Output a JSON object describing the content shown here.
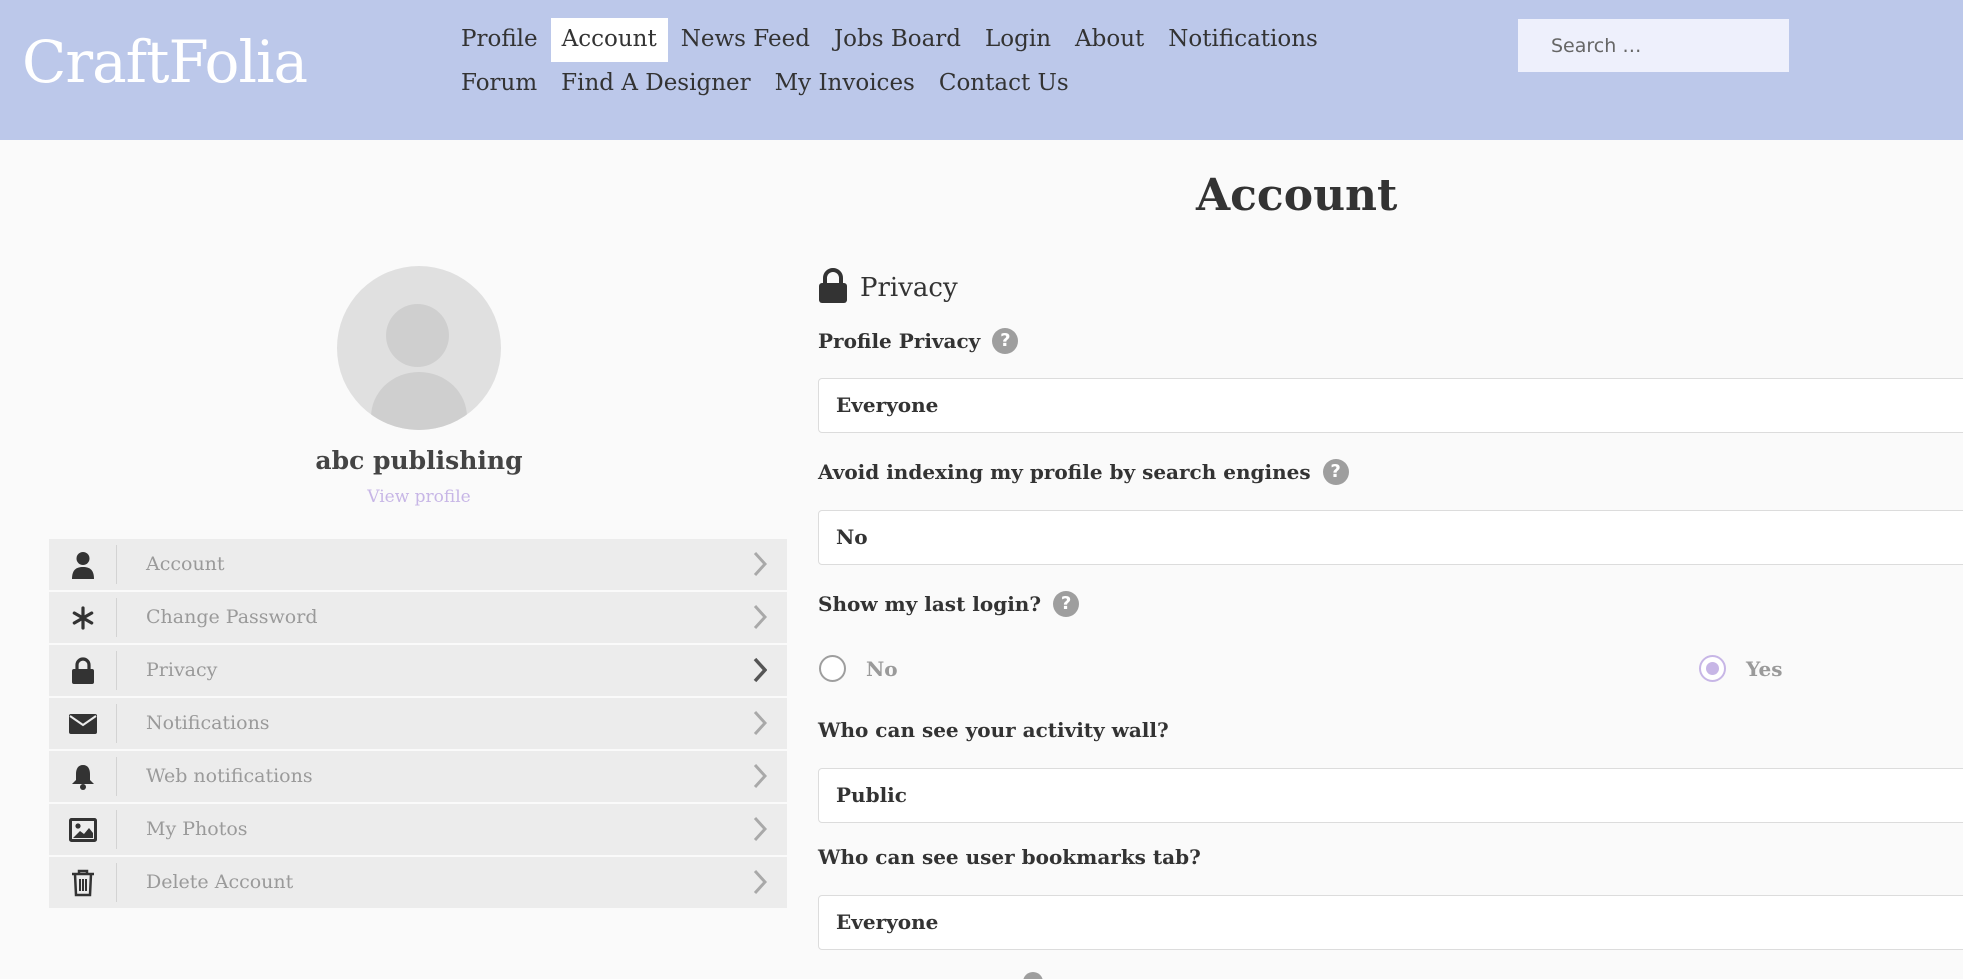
{
  "site": {
    "logo": "CraftFolia"
  },
  "nav": {
    "items": [
      {
        "label": "Profile",
        "active": false
      },
      {
        "label": "Account",
        "active": true
      },
      {
        "label": "News Feed",
        "active": false
      },
      {
        "label": "Jobs Board",
        "active": false
      },
      {
        "label": "Login",
        "active": false
      },
      {
        "label": "About",
        "active": false
      },
      {
        "label": "Notifications",
        "active": false
      },
      {
        "label": "Forum",
        "active": false
      },
      {
        "label": "Find A Designer",
        "active": false
      },
      {
        "label": "My Invoices",
        "active": false
      },
      {
        "label": "Contact Us",
        "active": false
      }
    ]
  },
  "search": {
    "placeholder": "Search …"
  },
  "page": {
    "title": "Account"
  },
  "user": {
    "name": "abc publishing",
    "view_profile": "View profile"
  },
  "sidebar": {
    "items": [
      {
        "label": "Account",
        "icon": "user-icon"
      },
      {
        "label": "Change Password",
        "icon": "asterisk-icon"
      },
      {
        "label": "Privacy",
        "icon": "lock-icon"
      },
      {
        "label": "Notifications",
        "icon": "envelope-icon"
      },
      {
        "label": "Web notifications",
        "icon": "bell-icon"
      },
      {
        "label": "My Photos",
        "icon": "image-icon"
      },
      {
        "label": "Delete Account",
        "icon": "trash-icon"
      }
    ]
  },
  "privacy": {
    "section_title": "Privacy",
    "profile_privacy": {
      "label": "Profile Privacy",
      "value": "Everyone"
    },
    "avoid_indexing": {
      "label": "Avoid indexing my profile by search engines",
      "value": "No"
    },
    "show_last_login": {
      "label": "Show my last login?",
      "options": [
        "No",
        "Yes"
      ],
      "selected": "Yes"
    },
    "activity_wall": {
      "label": "Who can see your activity wall?",
      "value": "Public"
    },
    "bookmarks_tab": {
      "label": "Who can see user bookmarks tab?",
      "value": "Everyone"
    }
  },
  "colors": {
    "header_bg": "#bcc8ea",
    "accent": "#c7b6e6",
    "help_icon": "#9e9e9e"
  }
}
